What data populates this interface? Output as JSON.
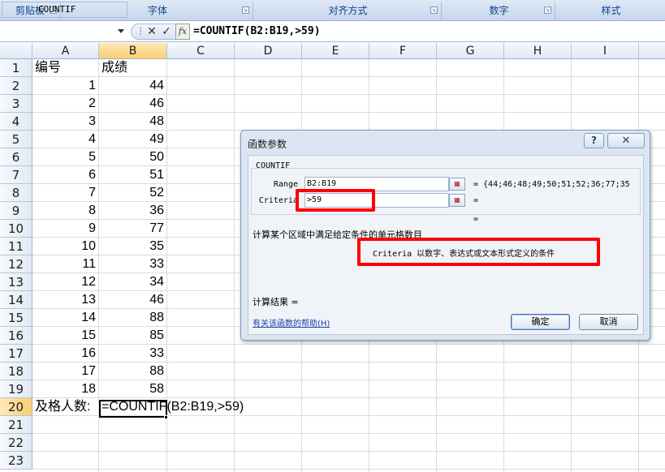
{
  "ribbon": {
    "groups": [
      {
        "label": "剪贴板"
      },
      {
        "label": "字体"
      },
      {
        "label": "对齐方式"
      },
      {
        "label": "数字"
      },
      {
        "label": "样式"
      }
    ]
  },
  "formula_bar": {
    "name_box": "COUNTIF",
    "cancel_glyph": "✕",
    "enter_glyph": "✓",
    "fx_label": "fx",
    "formula": "=COUNTIF(B2:B19,>59)"
  },
  "sheet": {
    "columns": [
      "A",
      "B",
      "C",
      "D",
      "E",
      "F",
      "G",
      "H",
      "I"
    ],
    "rows": [
      "1",
      "2",
      "3",
      "4",
      "5",
      "6",
      "7",
      "8",
      "9",
      "10",
      "11",
      "12",
      "13",
      "14",
      "15",
      "16",
      "17",
      "18",
      "19",
      "20",
      "21",
      "22",
      "23"
    ],
    "header_a": "编号",
    "header_b": "成绩",
    "ids": [
      "1",
      "2",
      "3",
      "4",
      "5",
      "6",
      "7",
      "8",
      "9",
      "10",
      "11",
      "12",
      "13",
      "14",
      "15",
      "16",
      "17",
      "18"
    ],
    "scores": [
      "44",
      "46",
      "48",
      "49",
      "50",
      "51",
      "52",
      "36",
      "77",
      "35",
      "33",
      "34",
      "46",
      "88",
      "85",
      "33",
      "88",
      "58"
    ],
    "a20": "及格人数:",
    "b20": "=COUNTIF(B2:B19,>59)"
  },
  "dialog": {
    "title": "函数参数",
    "help_button": "?",
    "close_button": "✕",
    "function_name": "COUNTIF",
    "range_label": "Range",
    "range_value": "B2:B19",
    "range_result": "= {44;46;48;49;50;51;52;36;77;35",
    "criteria_label": "Criteria",
    "criteria_value": ">59",
    "criteria_result": "=",
    "function_result": "=",
    "description": "计算某个区域中满足给定条件的单元格数目",
    "arg_description": "Criteria  以数字、表达式或文本形式定义的条件",
    "calc_result_label": "计算结果 =",
    "help_link": "有关该函数的帮助(H)",
    "ok_button": "确定",
    "cancel_button": "取消"
  }
}
